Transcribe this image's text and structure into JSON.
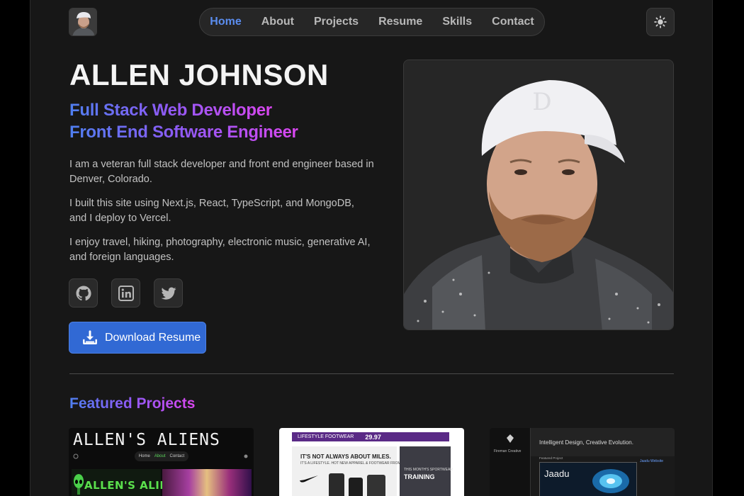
{
  "header": {
    "nav": [
      "Home",
      "About",
      "Projects",
      "Resume",
      "Skills",
      "Contact"
    ],
    "active_nav": "Home",
    "theme_icon": "sun-icon"
  },
  "hero": {
    "name": "ALLEN JOHNSON",
    "role_1": "Full Stack Web Developer",
    "role_2": "Front End Software Engineer",
    "paragraphs": [
      "I am a veteran full stack developer and front end engineer based in Denver, Colorado.",
      "I built this site using Next.js, React, TypeScript, and MongoDB, and I deploy to Vercel.",
      "I enjoy travel, hiking, photography, electronic music, generative AI, and foreign languages."
    ],
    "social": [
      "github-icon",
      "linkedin-icon",
      "twitter-icon"
    ],
    "download_label": "Download Resume"
  },
  "projects": {
    "title": "Featured Projects",
    "aliens": {
      "title": "ALLEN'S ALIENS",
      "nav": [
        "Home",
        "About",
        "Contact"
      ],
      "logo_text": "ALLEN'S ALIENS"
    },
    "nike": {
      "banner_left": "LIFESTYLE FOOTWEAR",
      "banner_price": "29.97",
      "headline": "IT'S NOT ALWAYS ABOUT MILES.",
      "subline": "IT'S A LIFESTYLE. HOT NEW APPAREL & FOOTWEAR FROM NIKE",
      "right_small": "THIS MONTH'S SPORTWEAR",
      "right_big": "TRAINING"
    },
    "jaadu": {
      "tagline": "Intelligent Design, Creative Evolution.",
      "sidebar_title": "Fireman Creative",
      "featured": "Featured Project",
      "name": "Jaadu",
      "right_title": "Jaadu Website"
    }
  },
  "colors": {
    "accent": "#5b8def",
    "button": "#3169d4",
    "background": "#171717",
    "gradient_start": "#4f7ff0",
    "gradient_end": "#d946ef"
  }
}
